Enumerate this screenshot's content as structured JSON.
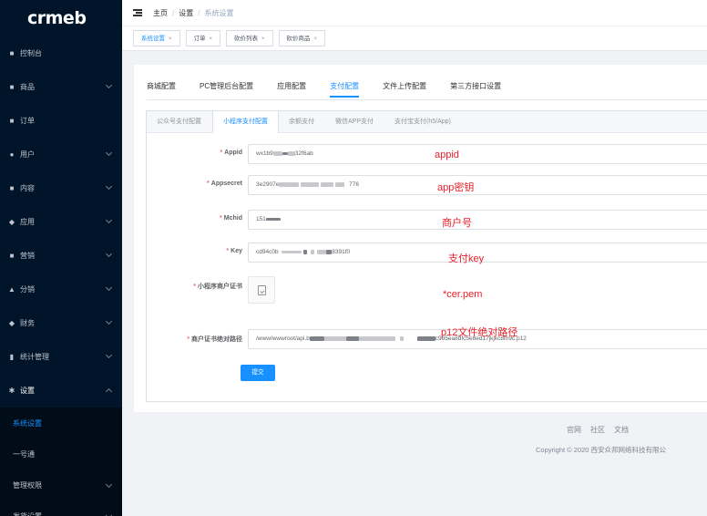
{
  "app": {
    "logo": "crmeb"
  },
  "sidebar": {
    "items": [
      {
        "label": "控制台",
        "icon": "dashboard-icon",
        "glyph": "■",
        "chevron": false
      },
      {
        "label": "商品",
        "icon": "goods-icon",
        "glyph": "■",
        "chevron": true
      },
      {
        "label": "订单",
        "icon": "order-icon",
        "glyph": "■",
        "chevron": false
      },
      {
        "label": "用户",
        "icon": "user-icon",
        "glyph": "●",
        "chevron": true
      },
      {
        "label": "内容",
        "icon": "content-icon",
        "glyph": "■",
        "chevron": true
      },
      {
        "label": "应用",
        "icon": "app-icon",
        "glyph": "◆",
        "chevron": true
      },
      {
        "label": "营销",
        "icon": "marketing-icon",
        "glyph": "■",
        "chevron": true
      },
      {
        "label": "分销",
        "icon": "distribution-icon",
        "glyph": "▲",
        "chevron": true
      },
      {
        "label": "财务",
        "icon": "finance-icon",
        "glyph": "◆",
        "chevron": true
      },
      {
        "label": "统计管理",
        "icon": "statistics-icon",
        "glyph": "▮",
        "chevron": true
      },
      {
        "label": "设置",
        "icon": "settings-icon",
        "glyph": "✱",
        "chevron": "up"
      }
    ],
    "submenu": [
      {
        "label": "系统设置",
        "active": true,
        "chevron": false
      },
      {
        "label": "一号通",
        "active": false,
        "chevron": false
      },
      {
        "label": "管理权限",
        "active": false,
        "chevron": true
      },
      {
        "label": "发货设置",
        "active": false,
        "chevron": true
      }
    ]
  },
  "header": {
    "breadcrumb": [
      "主页",
      "设置",
      "系统设置"
    ],
    "separator": "/"
  },
  "tags": [
    {
      "label": "系统设置",
      "active": true
    },
    {
      "label": "订单",
      "active": false
    },
    {
      "label": "砍价列表",
      "active": false
    },
    {
      "label": "砍价商品",
      "active": false
    }
  ],
  "tag_close": "×",
  "main_tabs": [
    {
      "label": "商城配置",
      "active": false
    },
    {
      "label": "PC管理后台配置",
      "active": false
    },
    {
      "label": "应用配置",
      "active": false
    },
    {
      "label": "支付配置",
      "active": true
    },
    {
      "label": "文件上传配置",
      "active": false
    },
    {
      "label": "第三方接口设置",
      "active": false
    }
  ],
  "sub_tabs": [
    {
      "label": "公众号支付配置",
      "active": false
    },
    {
      "label": "小程序支付配置",
      "active": true
    },
    {
      "label": "余额支付",
      "active": false
    },
    {
      "label": "微信APP支付",
      "active": false
    },
    {
      "label": "支付宝支付(h5/App)",
      "active": false
    }
  ],
  "form": {
    "required_mark": "*",
    "appid": {
      "label": "Appid",
      "value_prefix": "wx1b9",
      "value_suffix": "32f6ab",
      "note": "appid"
    },
    "appsecret": {
      "label": "Appsecret",
      "value_prefix": "3e2907e",
      "value_suffix": "776",
      "note": "app密钥"
    },
    "mchid": {
      "label": "Mchid",
      "value_prefix": "151",
      "value_suffix": "",
      "note": "商户号"
    },
    "key": {
      "label": "Key",
      "value_prefix": "cd94c0b",
      "value_suffix": "8391f0",
      "note": "支付key"
    },
    "cert": {
      "label": "小程序商户证书",
      "note": "*cer.pem"
    },
    "cert_path": {
      "label": "商户证书绝对路径",
      "value_prefix": "/www/wwwroot/api.b",
      "value_suffix": "c985ea8dfc5e8ed17jkjkc8fn9c.p12",
      "note": "p12文件绝对路径"
    },
    "submit_label": "提交"
  },
  "footer": {
    "links": [
      "官网",
      "社区",
      "文档"
    ],
    "copyright": "Copyright © 2020 西安众邦网络科技有限公"
  }
}
